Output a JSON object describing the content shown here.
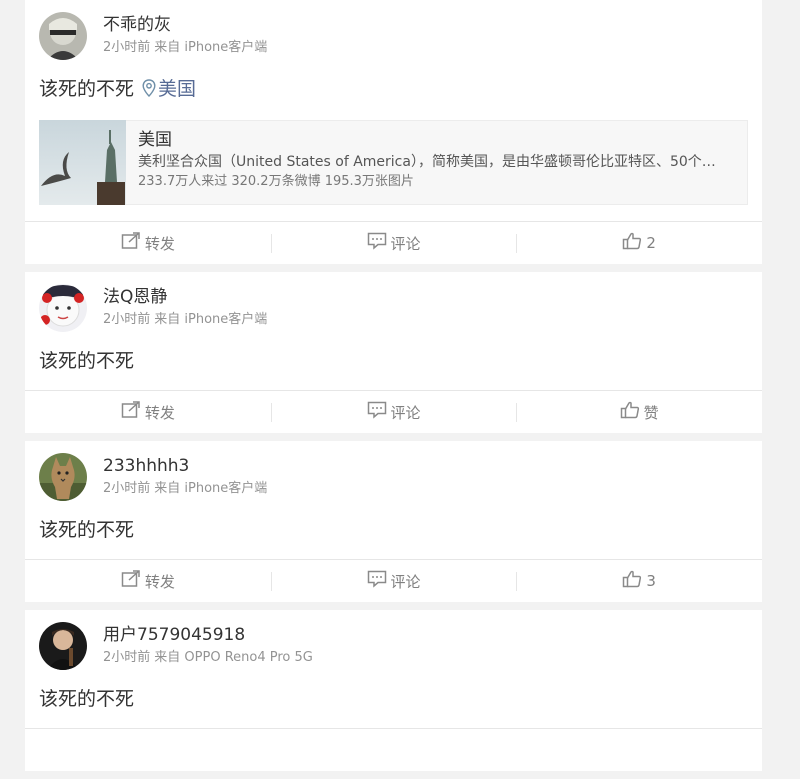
{
  "posts": [
    {
      "username": "不乖的灰",
      "time": "2小时前",
      "source": "来自 iPhone客户端",
      "text": "该死的不死",
      "location": "美国",
      "place_card": {
        "name": "美国",
        "desc": "美利坚合众国（United States of America），简称美国，是由华盛顿哥伦比亚特区、50个…",
        "stats": "233.7万人来过 320.2万条微博 195.3万张图片"
      },
      "actions": {
        "repost": "转发",
        "comment": "评论",
        "like": "2"
      }
    },
    {
      "username": "法Q恩静",
      "time": "2小时前",
      "source": "来自 iPhone客户端",
      "text": "该死的不死",
      "actions": {
        "repost": "转发",
        "comment": "评论",
        "like": "赞"
      }
    },
    {
      "username": "233hhhh3",
      "time": "2小时前",
      "source": "来自 iPhone客户端",
      "text": "该死的不死",
      "actions": {
        "repost": "转发",
        "comment": "评论",
        "like": "3"
      }
    },
    {
      "username": "用户7579045918",
      "time": "2小时前",
      "source": "来自 OPPO Reno4 Pro 5G",
      "text": "该死的不死"
    }
  ],
  "colors": {
    "background": "#f2f2f2",
    "card": "#ffffff",
    "link": "#576b95",
    "muted": "#939393"
  }
}
